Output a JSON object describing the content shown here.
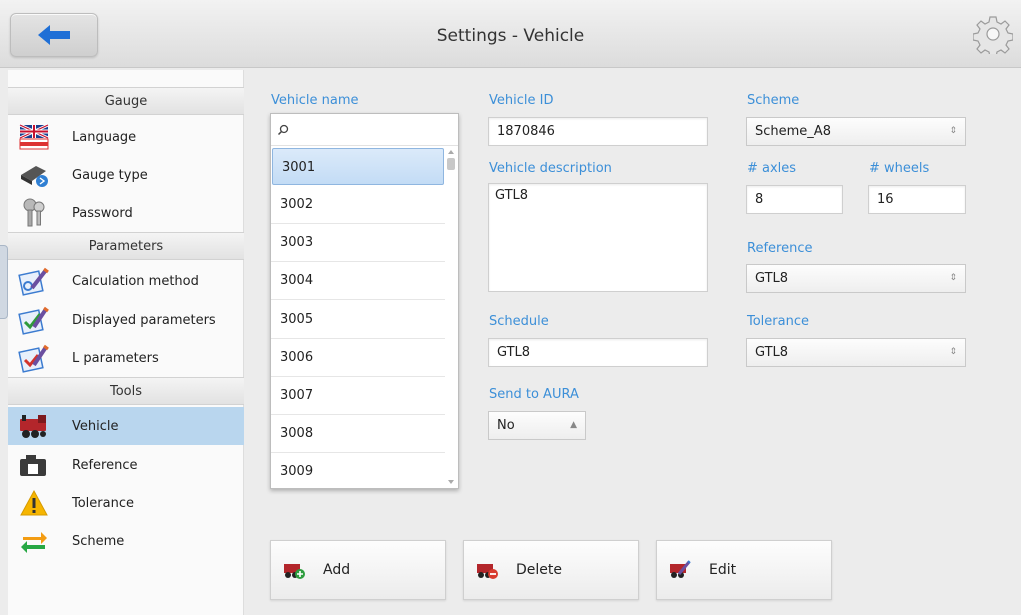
{
  "header": {
    "title": "Settings - Vehicle"
  },
  "sidebar": {
    "sections": [
      {
        "title": "Gauge"
      },
      {
        "title": "Parameters"
      },
      {
        "title": "Tools"
      }
    ],
    "items": [
      {
        "label": "Language",
        "icon": "uk-flag-icon"
      },
      {
        "label": "Gauge type",
        "icon": "gauge-device-icon"
      },
      {
        "label": "Password",
        "icon": "keys-icon"
      },
      {
        "label": "Calculation method",
        "icon": "calculation-icon"
      },
      {
        "label": "Displayed parameters",
        "icon": "checklist-icon"
      },
      {
        "label": "L parameters",
        "icon": "clipboard-edit-icon"
      },
      {
        "label": "Vehicle",
        "icon": "train-icon",
        "active": true
      },
      {
        "label": "Reference",
        "icon": "camera-icon"
      },
      {
        "label": "Tolerance",
        "icon": "warning-icon"
      },
      {
        "label": "Scheme",
        "icon": "swap-arrows-icon"
      }
    ]
  },
  "vehicle_list": {
    "label": "Vehicle name",
    "search_placeholder": "",
    "rows": [
      "3001",
      "3002",
      "3003",
      "3004",
      "3005",
      "3006",
      "3007",
      "3008",
      "3009"
    ],
    "selected": "3001"
  },
  "form": {
    "vehicle_id_label": "Vehicle ID",
    "vehicle_id": "1870846",
    "vehicle_description_label": "Vehicle description",
    "vehicle_description": "GTL8",
    "schedule_label": "Schedule",
    "schedule": "GTL8",
    "send_to_aura_label": "Send to AURA",
    "send_to_aura": "No",
    "scheme_label": "Scheme",
    "scheme": "Scheme_A8",
    "axles_label": "# axles",
    "axles": "8",
    "wheels_label": "# wheels",
    "wheels": "16",
    "reference_label": "Reference",
    "reference": "GTL8",
    "tolerance_label": "Tolerance",
    "tolerance": "GTL8"
  },
  "actions": {
    "add_label": "Add",
    "delete_label": "Delete",
    "edit_label": "Edit"
  },
  "colors": {
    "accent_label": "#3c8fd8",
    "active_item": "#b9d6ee",
    "back_arrow": "#1f6fd6"
  }
}
